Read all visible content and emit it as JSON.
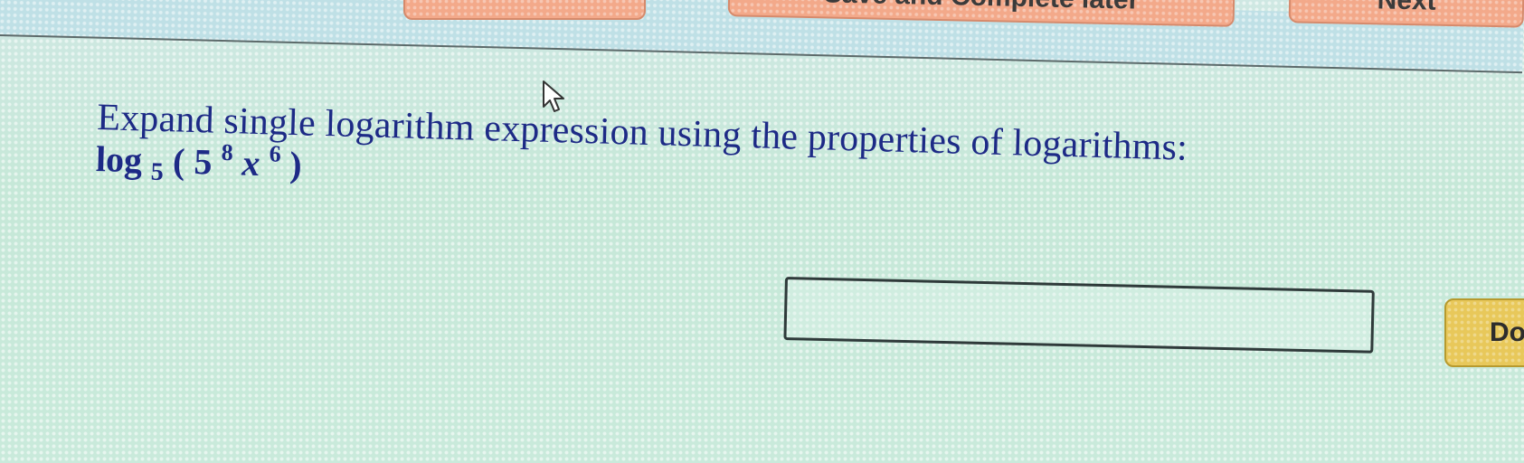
{
  "toolbar": {
    "prev_label": "",
    "save_label": "Save and Complete later",
    "next_label": "Next"
  },
  "question": {
    "prompt": "Expand single logarithm expression using the properties of logarithms:",
    "expression": {
      "func": "log",
      "base": "5",
      "open_paren": "(",
      "term1": "5",
      "term1_exp": "8",
      "term2": "x",
      "term2_exp": "6",
      "close_paren": ")"
    }
  },
  "answer": {
    "value": "",
    "placeholder": ""
  },
  "actions": {
    "done_label": "Do"
  },
  "icons": {
    "pointer": "mouse-pointer-icon"
  },
  "colors": {
    "text_primary": "#1d2a86",
    "nav_button": "#f3a98a",
    "done_button": "#e8c85a",
    "background": "#c9e9de"
  }
}
